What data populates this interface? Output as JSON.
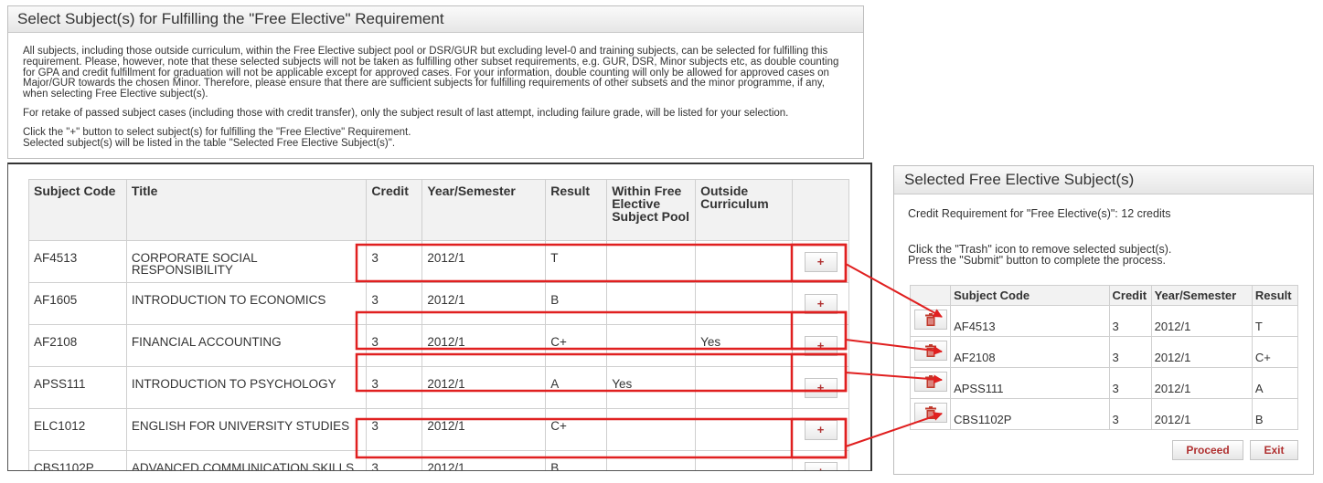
{
  "left_panel": {
    "title": "Select Subject(s) for Fulfilling the \"Free Elective\" Requirement",
    "para1": "All subjects, including those outside curriculum, within the Free Elective subject pool or DSR/GUR but excluding level-0 and training subjects, can be selected for fulfilling this requirement. Please, however, note that these selected subjects will not be taken as fulfilling other subset requirements, e.g. GUR, DSR, Minor subjects etc, as double counting for GPA and credit fulfillment for graduation will not be applicable except for approved cases. For your information, double counting will only be allowed for approved cases on Major/GUR towards the chosen Minor. Therefore, please ensure that there are sufficient subjects for fulfilling requirements of other subsets and the minor programme, if any, when selecting Free Elective subject(s).",
    "para2": "For retake of passed subject cases (including those with credit transfer), only the subject result of last attempt, including failure grade, will be listed for your selection.",
    "para3_line1": "Click the \"+\" button to select subject(s) for fulfilling the \"Free Elective\" Requirement.",
    "para3_line2": "Selected subject(s) will be listed in the table \"Selected Free Elective Subject(s)\"."
  },
  "subjects_table": {
    "headers": {
      "code": "Subject Code",
      "title": "Title",
      "credit": "Credit",
      "year": "Year/Semester",
      "result": "Result",
      "within": "Within Free Elective Subject Pool",
      "outside": "Outside Curriculum"
    },
    "add_label": "+",
    "rows": [
      {
        "code": "AF4513",
        "title": "CORPORATE SOCIAL RESPONSIBILITY",
        "credit": "3",
        "year": "2012/1",
        "result": "T",
        "within": "",
        "outside": ""
      },
      {
        "code": "AF1605",
        "title": "INTRODUCTION TO ECONOMICS",
        "credit": "3",
        "year": "2012/1",
        "result": "B",
        "within": "",
        "outside": ""
      },
      {
        "code": "AF2108",
        "title": "FINANCIAL ACCOUNTING",
        "credit": "3",
        "year": "2012/1",
        "result": "C+",
        "within": "",
        "outside": "Yes"
      },
      {
        "code": "APSS111",
        "title": "INTRODUCTION TO PSYCHOLOGY",
        "credit": "3",
        "year": "2012/1",
        "result": "A",
        "within": "Yes",
        "outside": ""
      },
      {
        "code": "ELC1012",
        "title": "ENGLISH FOR UNIVERSITY STUDIES",
        "credit": "3",
        "year": "2012/1",
        "result": "C+",
        "within": "",
        "outside": ""
      },
      {
        "code": "CBS1102P",
        "title": "ADVANCED COMMUNICATION SKILLS IN CHINESE",
        "credit": "3",
        "year": "2012/1",
        "result": "B",
        "within": "",
        "outside": ""
      }
    ]
  },
  "right_panel": {
    "title": "Selected Free Elective Subject(s)",
    "credit_requirement": "Credit Requirement for \"Free Elective(s)\": 12 credits",
    "instruction1": "Click the \"Trash\" icon to remove selected subject(s).",
    "instruction2": "Press the \"Submit\" button to complete the process.",
    "headers": {
      "code": "Subject Code",
      "credit": "Credit",
      "year": "Year/Semester",
      "result": "Result"
    },
    "rows": [
      {
        "code": "AF4513",
        "credit": "3",
        "year": "2012/1",
        "result": "T"
      },
      {
        "code": "AF2108",
        "credit": "3",
        "year": "2012/1",
        "result": "C+"
      },
      {
        "code": "APSS111",
        "credit": "3",
        "year": "2012/1",
        "result": "A"
      },
      {
        "code": "CBS1102P",
        "credit": "3",
        "year": "2012/1",
        "result": "B"
      }
    ],
    "proceed_label": "Proceed",
    "exit_label": "Exit"
  },
  "icons": {
    "trash": "trash-icon",
    "add": "plus-icon"
  },
  "colors": {
    "annotation": "#e02020",
    "button_text": "#b03030",
    "header_bg": "#f2f2f2"
  }
}
